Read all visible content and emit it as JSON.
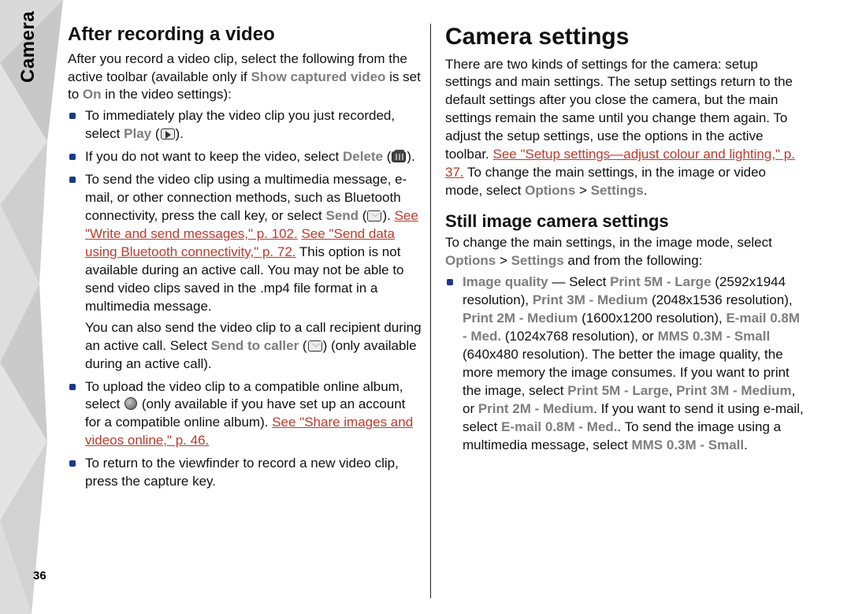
{
  "sideLabel": "Camera",
  "pageNumber": "36",
  "left": {
    "h2": "After recording a video",
    "intro_pre": "After you record a video clip, select the following from the active toolbar (available only if ",
    "intro_gray1": "Show captured video",
    "intro_mid": " is set to ",
    "intro_gray2": "On",
    "intro_post": " in the video settings):",
    "li1_a": "To immediately play the video clip you just recorded, select ",
    "li1_play": "Play",
    "li1_b": " (",
    "li1_c": ").",
    "li2_a": "If you do not want to keep the video, select ",
    "li2_delete": "Delete",
    "li2_b": " (",
    "li2_c": ").",
    "li3_a": "To send the video clip using a multimedia message, e-mail, or other connection methods, such as Bluetooth connectivity, press the call key, or select ",
    "li3_send": "Send",
    "li3_b": " (",
    "li3_c": "). ",
    "li3_link1": "See \"Write and send messages,\" p. 102.",
    "li3_d": " ",
    "li3_link2": "See \"Send data using Bluetooth connectivity,\" p. 72.",
    "li3_e": " This option is not available during an active call. You may not be able to send video clips saved in the .mp4 file format in a multimedia message.",
    "li3sub_a": "You can also send the video clip to a call recipient during an active call. Select ",
    "li3sub_gray": "Send to caller",
    "li3sub_b": " (",
    "li3sub_c": ") (only available during an active call).",
    "li4_a": "To upload the video clip to a compatible online album, select ",
    "li4_b": " (only available if you have set up an account for a compatible online album). ",
    "li4_link": "See \"Share images and videos online,\" p. 46.",
    "li5": "To return to the viewfinder to record a new video clip, press the capture key."
  },
  "right": {
    "h1": "Camera settings",
    "p1_a": "There are two kinds of settings for the camera: setup settings and main settings. The setup settings return to the default settings after you close the camera, but the main settings remain the same until you change them again. To adjust the setup settings, use the options in the active toolbar. ",
    "p1_link": "See \"Setup settings—adjust colour and lighting,\" p. 37.",
    "p1_b": " To change the main settings, in the image or video mode, select ",
    "p1_gray1": "Options",
    "p1_c": " > ",
    "p1_gray2": "Settings",
    "p1_d": ".",
    "h3": "Still image camera settings",
    "p2_a": "To change the main settings, in the image mode, select ",
    "p2_gray1": "Options",
    "p2_b": " > ",
    "p2_gray2": "Settings",
    "p2_c": " and from the following:",
    "li1_bold": "Image quality",
    "li1_a": " — Select ",
    "li1_g1": "Print 5M - Large",
    "li1_b": " (2592x1944 resolution), ",
    "li1_g2": "Print 3M - Medium",
    "li1_c": " (2048x1536 resolution), ",
    "li1_g3": "Print 2M - Medium",
    "li1_d": " (1600x1200 resolution), ",
    "li1_g4": "E-mail 0.8M - Med.",
    "li1_e": " (1024x768 resolution), or ",
    "li1_g5": "MMS 0.3M - Small",
    "li1_f": " (640x480 resolution). The better the image quality, the more memory the image consumes. If you want to print the image, select ",
    "li1_g6": "Print 5M - Large",
    "li1_h": ", ",
    "li1_g7": "Print 3M - Medium",
    "li1_i": ", or ",
    "li1_g8": "Print 2M - Medium",
    "li1_j": ". If you want to send it using e-mail, select ",
    "li1_g9": "E-mail 0.8M - Med.",
    "li1_k": ". To send the image using a multimedia message, select ",
    "li1_g10": "MMS 0.3M - Small",
    "li1_l": "."
  }
}
